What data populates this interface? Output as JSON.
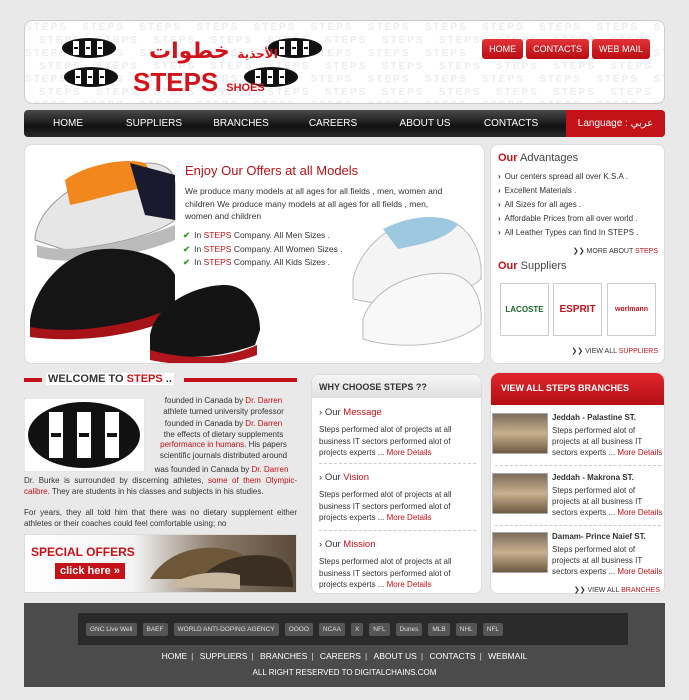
{
  "header": {
    "logo_arabic": "خطوات",
    "logo_arabic_sub": "الأحذية",
    "logo_main": "STEPS",
    "logo_sub": "SHOES",
    "watermark": "STEPS",
    "top_nav": [
      "HOME",
      "CONTACTS",
      "WEB MAIL"
    ]
  },
  "main_nav": {
    "items": [
      "HOME",
      "SUPPLIERS",
      "BRANCHES",
      "CAREERS",
      "ABOUT US",
      "CONTACTS"
    ],
    "language_label": "Language : ",
    "language_value": "عربي"
  },
  "hero": {
    "title": "Enjoy Our Offers at all Models",
    "description": "We produce many models at all ages for all fields , men, women and children We produce many models at all ages for all fields , men, women and children",
    "bullets": [
      {
        "prefix": "In ",
        "brand": "STEPS",
        "suffix": " Company. All Men Sizes ."
      },
      {
        "prefix": "In ",
        "brand": "STEPS",
        "suffix": " Company. All Women Sizes ."
      },
      {
        "prefix": "In ",
        "brand": "STEPS",
        "suffix": " Company. All Kids Sizes ."
      }
    ]
  },
  "advantages": {
    "title_red": "Our",
    "title_rest": " Advantages",
    "items": [
      "Our centers spread all over K.S.A .",
      "Excellent Materials .",
      "All Sizes for all ages .",
      "Affordable Prices from all over world .",
      "All Leather Types can find In STEPS ."
    ],
    "more_prefix": "MORE ABOUT ",
    "more_red": "STEPS"
  },
  "suppliers": {
    "title_red": "Our",
    "title_rest": " Suppliers",
    "logos": [
      "LACOSTE",
      "ESPRIT",
      "worlmann"
    ],
    "more_prefix": "VIEW ALL ",
    "more_red": "SUPPLIERS"
  },
  "welcome": {
    "title_prefix": "WELCOME TO ",
    "title_brand": "STEPS",
    "title_suffix": " ..",
    "p1a": "founded in Canada by ",
    "p1_name": "Dr. Darren",
    "p1b": "athlete turned university professor",
    "p2a": "founded in Canada by ",
    "p2_name": "Dr. Darren",
    "p2b": "the effects of dietary supplements",
    "p2_red": "performance in humans",
    "p2c": ". His papers scientific journals distributed around",
    "p3a": "was founded in Canada by ",
    "p3_name": "Dr. Darren",
    "p4a": "Dr. Burke is surrounded by discerning athletes, ",
    "p4_red": "some of them Olympic-calibre",
    "p4b": ". They are students in his classes and subjects in his studies.",
    "p5": "For years, they all told him that there was no dietary supplement either athletes or their coaches could feel comfortable using; no",
    "special_title": "SPECIAL OFFERS",
    "special_link": "click here"
  },
  "why": {
    "title": "WHY CHOOSE STEPS ??",
    "sections": [
      {
        "title_prefix": "Our ",
        "title_red": "Message",
        "text": "Steps performed alot of projects at all business IT sectors performed alot of projects experts ",
        "ellipsis": "...",
        "more": " More Details"
      },
      {
        "title_prefix": "Our ",
        "title_red": "Vision",
        "text": "Steps performed alot of projects at all business IT sectors performed alot of projects experts ",
        "ellipsis": "...",
        "more": " More Details"
      },
      {
        "title_prefix": "Our ",
        "title_red": "Mission",
        "text": "Steps performed alot of projects at all business IT sectors performed alot of projects experts ",
        "ellipsis": "...",
        "more": " More Details"
      }
    ]
  },
  "branches": {
    "title": "VIEW ALL STEPS BRANCHES",
    "items": [
      {
        "name": "Jeddah - Palastine ST.",
        "text": "Steps performed alot of projects at all business IT sectors experts ",
        "ellipsis": "...",
        "more": " More Details"
      },
      {
        "name": "Jeddah - Makrona ST.",
        "text": "Steps performed alot of projects at all business IT sectors experts ",
        "ellipsis": "...",
        "more": " More Details"
      },
      {
        "name": "Damam- Prince Naief ST.",
        "text": "Steps performed alot of projects at all business IT sectors experts ",
        "ellipsis": "...",
        "more": " More Details"
      }
    ],
    "more_prefix": "VIEW ALL ",
    "more_red": "BRANCHES"
  },
  "footer": {
    "sponsors": [
      "GNC Live Well",
      "BAEF",
      "WORLD ANTI-DOPING AGENCY",
      "OOOO",
      "NCAA",
      "X",
      "NFL",
      "Dunes",
      "MLB",
      "NHL",
      "NFL"
    ],
    "nav": [
      "HOME",
      "SUPPLIERS",
      "BRANCHES",
      "CAREERS",
      "ABOUT US",
      "CONTACTS",
      "WEBMAIL"
    ],
    "copyright": "ALL RIGHT RESERVED TO DIGITALCHAINS.COM"
  },
  "colors": {
    "accent_red": "#c41219",
    "check_green": "#3b9b2f",
    "footer_bg": "#4b4b4b"
  }
}
